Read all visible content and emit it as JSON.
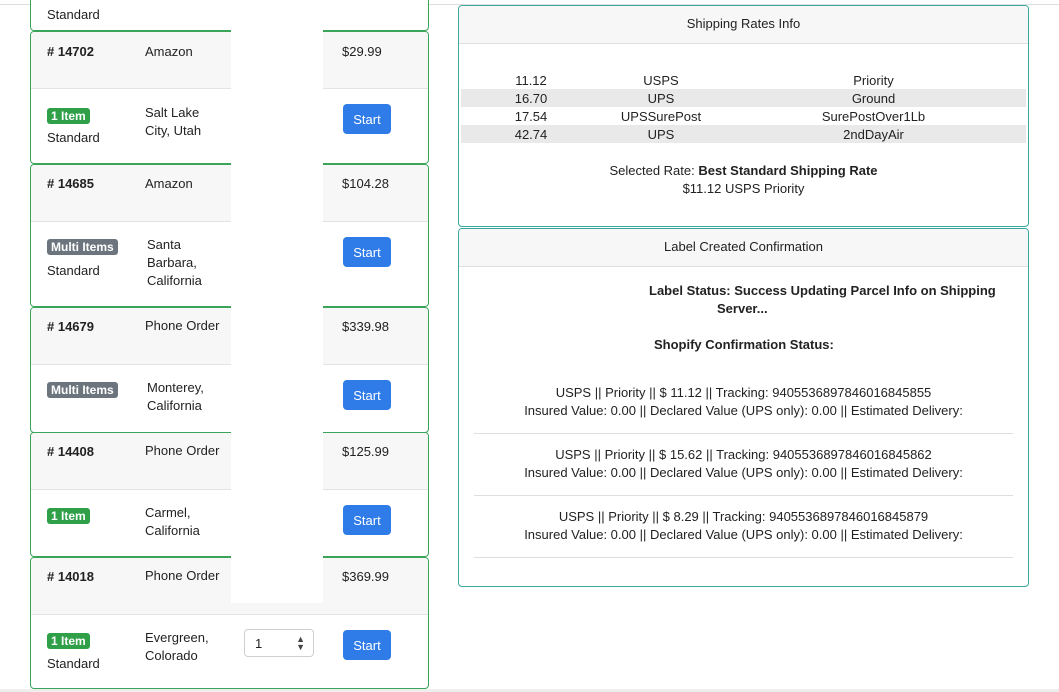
{
  "orders": [
    {
      "number": "",
      "channel": "",
      "status_text": "Standard",
      "price": ""
    },
    {
      "number": "# 14702",
      "channel": "Amazon",
      "price": "$29.99",
      "badge": "1 Item",
      "badge_color": "#2f9f48",
      "status_text": "Standard",
      "location": "Salt Lake City, Utah",
      "button": "Start"
    },
    {
      "number": "# 14685",
      "channel": "Amazon",
      "price": "$104.28",
      "badge": "Multi Items",
      "badge_color": "#6c757d",
      "status_text": "Standard",
      "location": "Santa Barbara, California",
      "button": "Start"
    },
    {
      "number": "# 14679",
      "channel": "Phone Order",
      "price": "$339.98",
      "badge": "Multi Items",
      "badge_color": "#6c757d",
      "status_text": "",
      "location": "Monterey, California",
      "button": "Start"
    },
    {
      "number": "# 14408",
      "channel": "Phone Order",
      "price": "$125.99",
      "badge": "1 Item",
      "badge_color": "#2f9f48",
      "status_text": "",
      "location": "Carmel, California",
      "button": "Start"
    },
    {
      "number": "# 14018",
      "channel": "Phone Order",
      "price": "$369.99",
      "badge": "1 Item",
      "badge_color": "#2f9f48",
      "status_text": "Standard",
      "location": "Evergreen, Colorado",
      "button": "Start",
      "quantity": "1"
    }
  ],
  "shipping_rates": {
    "title": "Shipping Rates Info",
    "rows": [
      {
        "price": "11.12",
        "carrier": "USPS",
        "service": "Priority"
      },
      {
        "price": "16.70",
        "carrier": "UPS",
        "service": "Ground"
      },
      {
        "price": "17.54",
        "carrier": "UPSSurePost",
        "service": "SurePostOver1Lb"
      },
      {
        "price": "42.74",
        "carrier": "UPS",
        "service": "2ndDayAir"
      }
    ],
    "selected_label": "Selected Rate:",
    "selected_value": "Best Standard Shipping Rate",
    "selected_detail": "$11.12 USPS Priority"
  },
  "label_confirmation": {
    "title": "Label Created Confirmation",
    "label_status_line1": "Label Status: Success Updating Parcel Info on Shipping",
    "label_status_line2": "Server...",
    "shopify_status": "Shopify Confirmation Status:",
    "entries": [
      {
        "line1": "USPS || Priority || $ 11.12 || Tracking: 9405536897846016845855",
        "line2": "Insured Value: 0.00 || Declared Value (UPS only): 0.00 || Estimated Delivery:"
      },
      {
        "line1": "USPS || Priority || $ 15.62 || Tracking: 9405536897846016845862",
        "line2": "Insured Value: 0.00 || Declared Value (UPS only): 0.00 || Estimated Delivery:"
      },
      {
        "line1": "USPS || Priority || $ 8.29 || Tracking: 9405536897846016845879",
        "line2": "Insured Value: 0.00 || Declared Value (UPS only): 0.00 || Estimated Delivery:"
      }
    ]
  },
  "colors": {
    "card_border": "#3aa558",
    "panel_border": "#39a9a0",
    "button": "#2f7be8",
    "badge_green": "#2f9f48",
    "badge_gray": "#6c757d"
  }
}
